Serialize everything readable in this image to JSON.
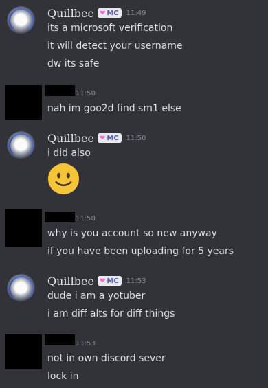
{
  "colors": {
    "background": "#323339",
    "text": "#dbdee1",
    "timestamp": "#8d909a",
    "tag_bg": "#e8e9ec",
    "tag_text": "#5b5cb8",
    "tag_heart": "#ee6ad0",
    "emoji_face": "#f5c437",
    "redaction": "#000000"
  },
  "messages": [
    {
      "author": "Quillbee",
      "tag_icon": "pink-heart-icon",
      "tag": "MC",
      "time": "11:49",
      "lines": [
        "its a microsoft verification",
        "it will detect your username",
        "dw its safe"
      ]
    },
    {
      "author_redacted": true,
      "time": "11:50",
      "lines": [
        "nah im goo2d find sm1 else"
      ]
    },
    {
      "author": "Quillbee",
      "tag_icon": "pink-heart-icon",
      "tag": "MC",
      "time": "11:50",
      "lines": [
        "i did also"
      ],
      "emoji": "slightly-smiling-face-icon"
    },
    {
      "author_redacted": true,
      "time": "11:50",
      "lines": [
        "why is you account so new anyway",
        "if you have been uploading for 5 years"
      ]
    },
    {
      "author": "Quillbee",
      "tag_icon": "pink-heart-icon",
      "tag": "MC",
      "time": "11:53",
      "lines": [
        "dude i am a yotuber",
        "i am diff alts for diff things"
      ]
    },
    {
      "author_redacted": true,
      "time": "11:53",
      "lines": [
        "not in own discord sever",
        "lock in"
      ]
    }
  ]
}
